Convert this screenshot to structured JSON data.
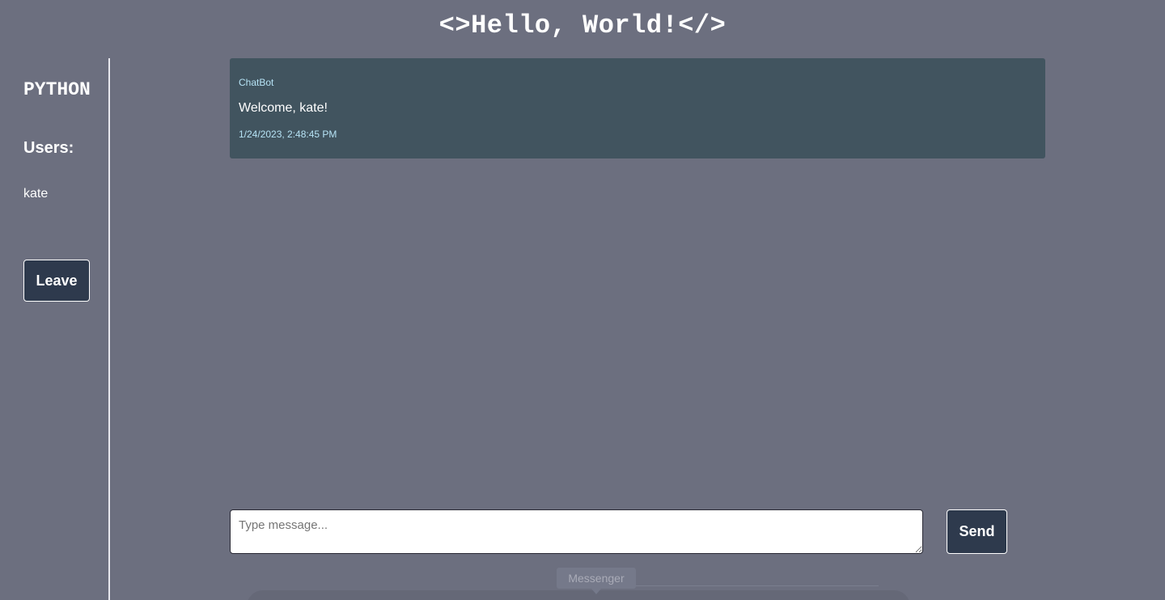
{
  "header": {
    "title": "<>Hello, World!</>"
  },
  "sidebar": {
    "room_name": "PYTHON",
    "users_heading": "Users:",
    "users": [
      "kate"
    ],
    "leave_label": "Leave"
  },
  "messages": [
    {
      "author": "ChatBot",
      "text": "Welcome, kate!",
      "time": "1/24/2023, 2:48:45 PM"
    }
  ],
  "composer": {
    "placeholder": "Type message...",
    "value": "",
    "send_label": "Send"
  },
  "dock": {
    "tab_label": "Messenger"
  },
  "colors": {
    "background": "#6c6f7f",
    "message_bg": "#41545f",
    "button_bg": "#2e3a4d",
    "meta_text": "#b6e3f5"
  }
}
